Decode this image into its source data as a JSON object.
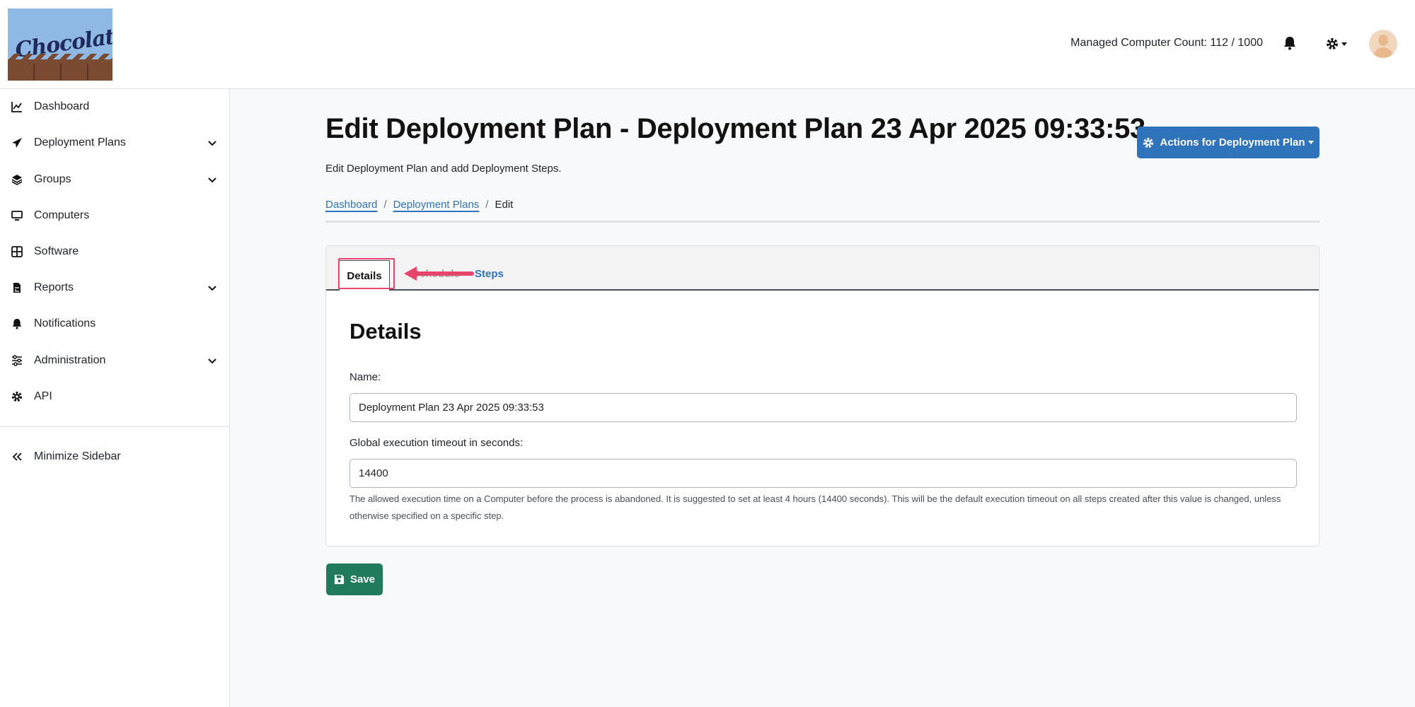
{
  "header": {
    "logo_text": "Chocolatey",
    "managed_count": "Managed Computer Count: 112 / 1000"
  },
  "sidebar": {
    "items": [
      {
        "label": "Dashboard",
        "icon": "chart-line-icon"
      },
      {
        "label": "Deployment Plans",
        "icon": "paper-plane-icon"
      },
      {
        "label": "Groups",
        "icon": "layers-icon"
      },
      {
        "label": "Computers",
        "icon": "desktop-icon"
      },
      {
        "label": "Software",
        "icon": "grid-icon"
      },
      {
        "label": "Reports",
        "icon": "report-file-icon"
      },
      {
        "label": "Notifications",
        "icon": "bell-icon"
      },
      {
        "label": "Administration",
        "icon": "sliders-icon"
      },
      {
        "label": "API",
        "icon": "gear-icon"
      }
    ],
    "minimize_label": "Minimize Sidebar"
  },
  "main": {
    "title": "Edit Deployment Plan - Deployment Plan 23 Apr 2025 09:33:53",
    "subtitle": "Edit Deployment Plan and add Deployment Steps.",
    "actions_label": "Actions for Deployment Plan",
    "breadcrumb": [
      "Dashboard",
      "Deployment Plans",
      "Edit"
    ],
    "tabs": [
      "Details",
      "Schedule",
      "Steps"
    ],
    "details_heading": "Details",
    "name_label": "Name:",
    "name_value": "Deployment Plan 23 Apr 2025 09:33:53",
    "timeout_label": "Global execution timeout in seconds:",
    "timeout_value": "14400",
    "help_text": "The allowed execution time on a Computer before the process is abandoned. It is suggested to set at least 4 hours (14400 seconds). This will be the default execution timeout on all steps created after this value is changed, unless otherwise specified on a specific step.",
    "save_label": "Save"
  },
  "colors": {
    "primary": "#2f73bb",
    "save": "#227a5c",
    "highlight": "#e5446d"
  }
}
